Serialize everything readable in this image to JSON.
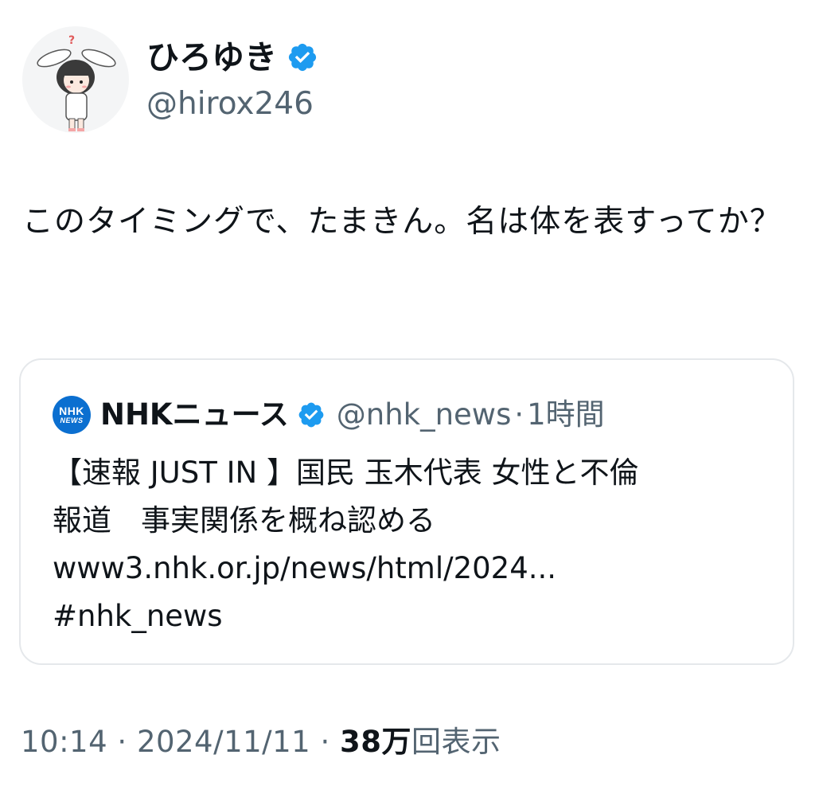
{
  "author": {
    "display_name": "ひろゆき",
    "handle": "@hirox246",
    "verified_color": "#1d9bf0"
  },
  "tweet": {
    "text": "このタイミングで、たまきん。名は体を表すってか？"
  },
  "quote": {
    "logo_line1": "NHK",
    "logo_line2": "NEWS",
    "name": "NHKニュース",
    "handle": "@nhk_news",
    "separator": "·",
    "time": "1時間",
    "line1": "【速報 JUST IN 】国民 玉木代表 女性と不倫",
    "line2": "報道　事実関係を概ね認める",
    "link": "www3.nhk.or.jp/news/html/2024...",
    "hashtag": "#nhk_news"
  },
  "meta": {
    "time": "10:14",
    "sep1": "·",
    "date": "2024/11/11",
    "sep2": "·",
    "views_count": "38万",
    "views_label": "回表示"
  }
}
